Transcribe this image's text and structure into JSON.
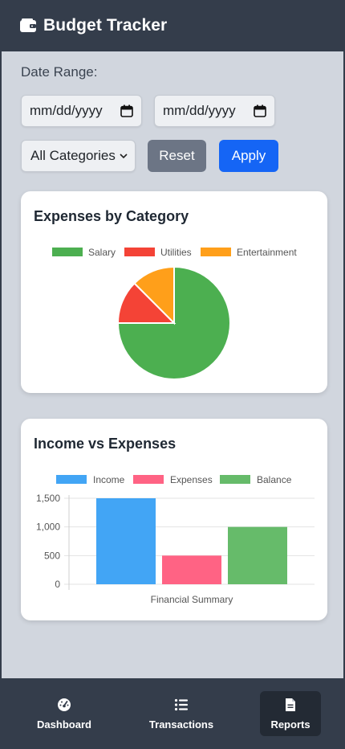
{
  "app": {
    "title": "Budget Tracker",
    "icon": "wallet-icon"
  },
  "filters": {
    "date_range_label": "Date Range:",
    "start_date_placeholder": "mm/dd/yyyy",
    "end_date_placeholder": "mm/dd/yyyy",
    "category_selected": "All Categories",
    "reset_label": "Reset",
    "apply_label": "Apply"
  },
  "cards": {
    "expenses": {
      "title": "Expenses by Category"
    },
    "income": {
      "title": "Income vs Expenses"
    }
  },
  "chart_data": [
    {
      "type": "pie",
      "title": "Expenses by Category",
      "categories": [
        "Salary",
        "Utilities",
        "Entertainment"
      ],
      "values": [
        75,
        12.5,
        12.5
      ],
      "colors": [
        "#4caf50",
        "#f44336",
        "#ff9f1a"
      ],
      "legend": "top"
    },
    {
      "type": "bar",
      "title": "Income vs Expenses",
      "xlabel": "Financial Summary",
      "ylabel": "",
      "categories": [
        "Financial Summary"
      ],
      "series": [
        {
          "name": "Income",
          "values": [
            1500
          ],
          "color": "#42a5f5"
        },
        {
          "name": "Expenses",
          "values": [
            500
          ],
          "color": "#ff6384"
        },
        {
          "name": "Balance",
          "values": [
            1000
          ],
          "color": "#66bb6a"
        }
      ],
      "yticks": [
        "1,500",
        "1,000",
        "500",
        "0"
      ],
      "ylim": [
        0,
        1500
      ],
      "grid": true,
      "legend": "top"
    }
  ],
  "nav": {
    "items": [
      {
        "label": "Dashboard",
        "icon": "gauge-icon"
      },
      {
        "label": "Transactions",
        "icon": "list-icon"
      },
      {
        "label": "Reports",
        "icon": "document-icon",
        "active": true
      }
    ]
  }
}
